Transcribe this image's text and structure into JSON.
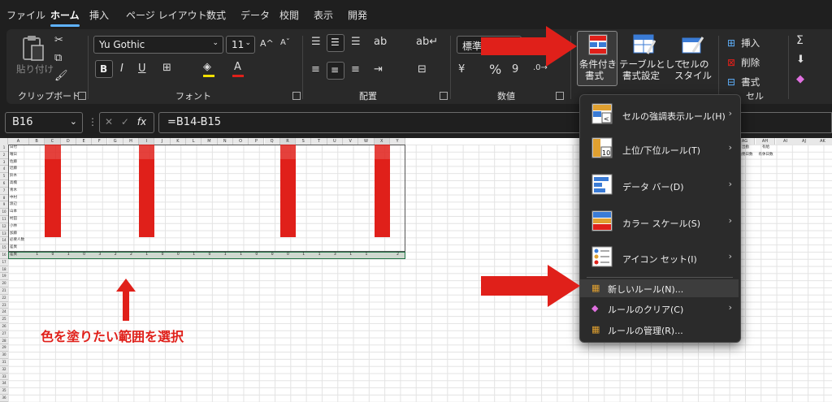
{
  "tabs": [
    "ファイル",
    "ホーム",
    "挿入",
    "ページ レイアウト",
    "数式",
    "データ",
    "校閲",
    "表示",
    "開発"
  ],
  "ribbon": {
    "clipboard": {
      "paste": "貼り付け",
      "label": "クリップボード"
    },
    "font": {
      "name": "Yu Gothic",
      "size": "11",
      "label": "フォント",
      "grow": "A^",
      "shrink": "Aˇ",
      "bold": "B",
      "italic": "I",
      "underline": "U"
    },
    "align": {
      "label": "配置"
    },
    "number": {
      "format": "標準",
      "label": "数値",
      "percent": "%",
      "comma": "9"
    },
    "styles": {
      "cond_format_l1": "条件付き",
      "cond_format_l2": "書式",
      "table_format_l1": "テーブルとして",
      "table_format_l2": "書式設定",
      "cell_styles_l1": "セルの",
      "cell_styles_l2": "スタイル"
    },
    "cells": {
      "insert": "挿入",
      "delete": "削除",
      "format": "書式",
      "label": "セル"
    },
    "edit": {
      "sum": "Σ"
    }
  },
  "formula_bar": {
    "name_box": "B16",
    "formula": "=B14-B15",
    "fx": "fx"
  },
  "dropdown": {
    "items": [
      {
        "label": "セルの強調表示ルール(H)",
        "submenu": true,
        "icon": "highlight-rules-icon"
      },
      {
        "label": "上位/下位ルール(T)",
        "submenu": true,
        "icon": "top-bottom-rules-icon"
      },
      {
        "label": "データ バー(D)",
        "submenu": true,
        "icon": "data-bars-icon"
      },
      {
        "label": "カラー スケール(S)",
        "submenu": true,
        "icon": "color-scales-icon"
      },
      {
        "label": "アイコン セット(I)",
        "submenu": true,
        "icon": "icon-sets-icon"
      }
    ],
    "small_items": [
      {
        "label": "新しいルール(N)...",
        "submenu": false,
        "icon": "new-rule-icon"
      },
      {
        "label": "ルールのクリア(C)",
        "submenu": true,
        "icon": "clear-rules-icon"
      },
      {
        "label": "ルールの管理(R)...",
        "submenu": false,
        "icon": "manage-rules-icon"
      }
    ]
  },
  "annotation": {
    "text": "色を塗りたい範囲を選択",
    "color": "#e0201a"
  },
  "sheet": {
    "columns": [
      "A",
      "B",
      "C",
      "D",
      "E",
      "F",
      "G",
      "H",
      "I",
      "J",
      "K",
      "L",
      "M",
      "N",
      "O",
      "P",
      "Q",
      "R",
      "S",
      "T",
      "U",
      "V",
      "W",
      "X",
      "Y"
    ],
    "far_columns": [
      "AG",
      "AH",
      "AI",
      "AJ",
      "AK"
    ],
    "rows": [
      "1",
      "2",
      "3",
      "4",
      "5",
      "6",
      "7",
      "8",
      "9",
      "10",
      "11",
      "12",
      "13",
      "14",
      "15",
      "16",
      "17",
      "18",
      "19",
      "20",
      "21",
      "22",
      "23",
      "24",
      "25",
      "26",
      "27",
      "28",
      "29",
      "30",
      "31",
      "32",
      "33",
      "34",
      "35",
      "36"
    ],
    "names": [
      "日付",
      "曜日",
      "佐藤",
      "近藤",
      "鈴木",
      "高橋",
      "青木",
      "中村",
      "渡辺",
      "山本",
      "村田",
      "小林",
      "加藤",
      "必要人数",
      "差異"
    ],
    "right_headers": [
      "出勤",
      "勤務日数",
      "有給",
      "有休日数"
    ],
    "diff_row": [
      "1",
      "0",
      "1",
      "0",
      "3",
      "2",
      "2",
      "1",
      "0",
      "0",
      "1",
      "0",
      "1",
      "1",
      "0",
      "0",
      "0",
      "1",
      "1",
      "3",
      "1",
      "1",
      "",
      "2"
    ]
  },
  "colors": {
    "highlight": "#e0201a",
    "accent": "#5fb2ff"
  }
}
